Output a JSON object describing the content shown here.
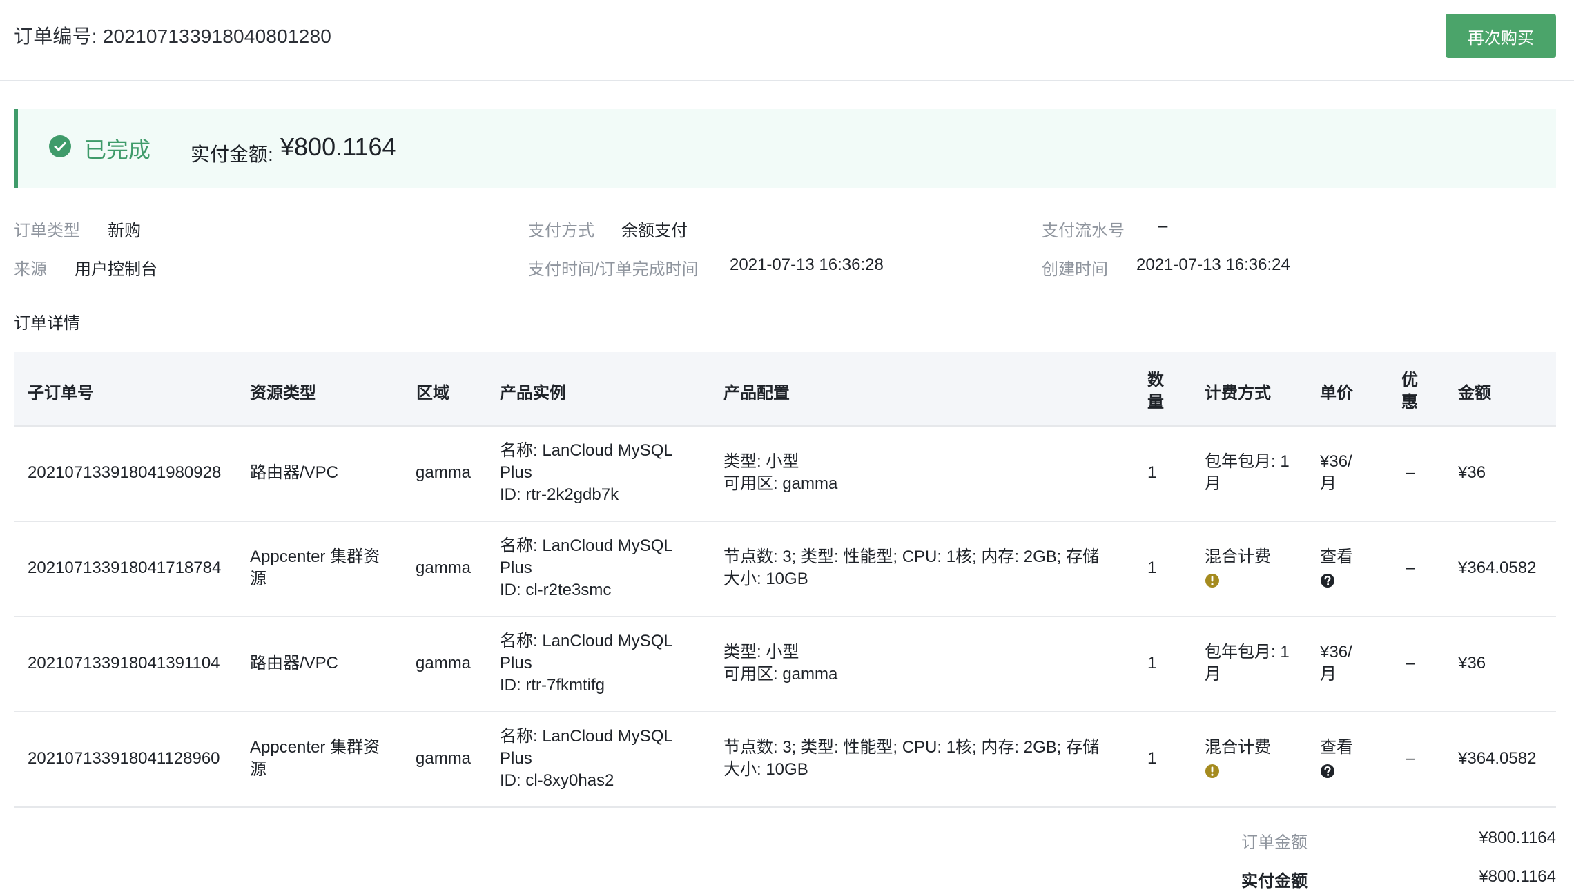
{
  "header": {
    "order_label": "订单编号:",
    "order_no": "202107133918040801280",
    "buy_again": "再次购买"
  },
  "status": {
    "state": "已完成",
    "paid_label": "实付金额:",
    "paid_value": "¥800.1164",
    "colors": {
      "success": "#3f9b6a",
      "banner_bg": "#f2fbf8",
      "button": "#4ba46a"
    }
  },
  "info": {
    "order_type_label": "订单类型",
    "order_type": "新购",
    "source_label": "来源",
    "source": "用户控制台",
    "pay_method_label": "支付方式",
    "pay_method": "余额支付",
    "pay_time_label": "支付时间/订单完成时间",
    "pay_time": "2021-07-13 16:36:28",
    "serial_label": "支付流水号",
    "serial": "–",
    "created_label": "创建时间",
    "created": "2021-07-13 16:36:24"
  },
  "details_title": "订单详情",
  "table": {
    "headers": {
      "sub_order": "子订单号",
      "resource_type": "资源类型",
      "region": "区域",
      "instance": "产品实例",
      "config": "产品配置",
      "qty_1": "数",
      "qty_2": "量",
      "billing": "计费方式",
      "unit_price": "单价",
      "discount_1": "优",
      "discount_2": "惠",
      "amount": "金额"
    },
    "rows": [
      {
        "sub_order": "202107133918041980928",
        "resource_type": "路由器/VPC",
        "region": "gamma",
        "instance": "名称: LanCloud MySQL\nPlus\nID: rtr-2k2gdb7k",
        "config": "类型: 小型\n可用区: gamma",
        "qty": "1",
        "billing": "包年包月: 1\n月",
        "unit_price": "¥36/\n月",
        "discount": "–",
        "amount": "¥36"
      },
      {
        "sub_order": "202107133918041718784",
        "resource_type": "Appcenter 集群资\n源",
        "region": "gamma",
        "instance": "名称: LanCloud MySQL\nPlus\nID: cl-r2te3smc",
        "config": "节点数: 3; 类型: 性能型; CPU: 1核; 内存: 2GB; 存储\n大小: 10GB",
        "qty": "1",
        "billing": "混合计费",
        "unit_price": "查看",
        "discount": "–",
        "amount": "¥364.0582"
      },
      {
        "sub_order": "202107133918041391104",
        "resource_type": "路由器/VPC",
        "region": "gamma",
        "instance": "名称: LanCloud MySQL\nPlus\nID: rtr-7fkmtifg",
        "config": "类型: 小型\n可用区: gamma",
        "qty": "1",
        "billing": "包年包月: 1\n月",
        "unit_price": "¥36/\n月",
        "discount": "–",
        "amount": "¥36"
      },
      {
        "sub_order": "202107133918041128960",
        "resource_type": "Appcenter 集群资\n源",
        "region": "gamma",
        "instance": "名称: LanCloud MySQL\nPlus\nID: cl-8xy0has2",
        "config": "节点数: 3; 类型: 性能型; CPU: 1核; 内存: 2GB; 存储\n大小: 10GB",
        "qty": "1",
        "billing": "混合计费",
        "unit_price": "查看",
        "discount": "–",
        "amount": "¥364.0582"
      }
    ]
  },
  "summary": {
    "order_amount_label": "订单金额",
    "order_amount": "¥800.1164",
    "paid_amount_label": "实付金额",
    "paid_amount": "¥800.1164"
  }
}
